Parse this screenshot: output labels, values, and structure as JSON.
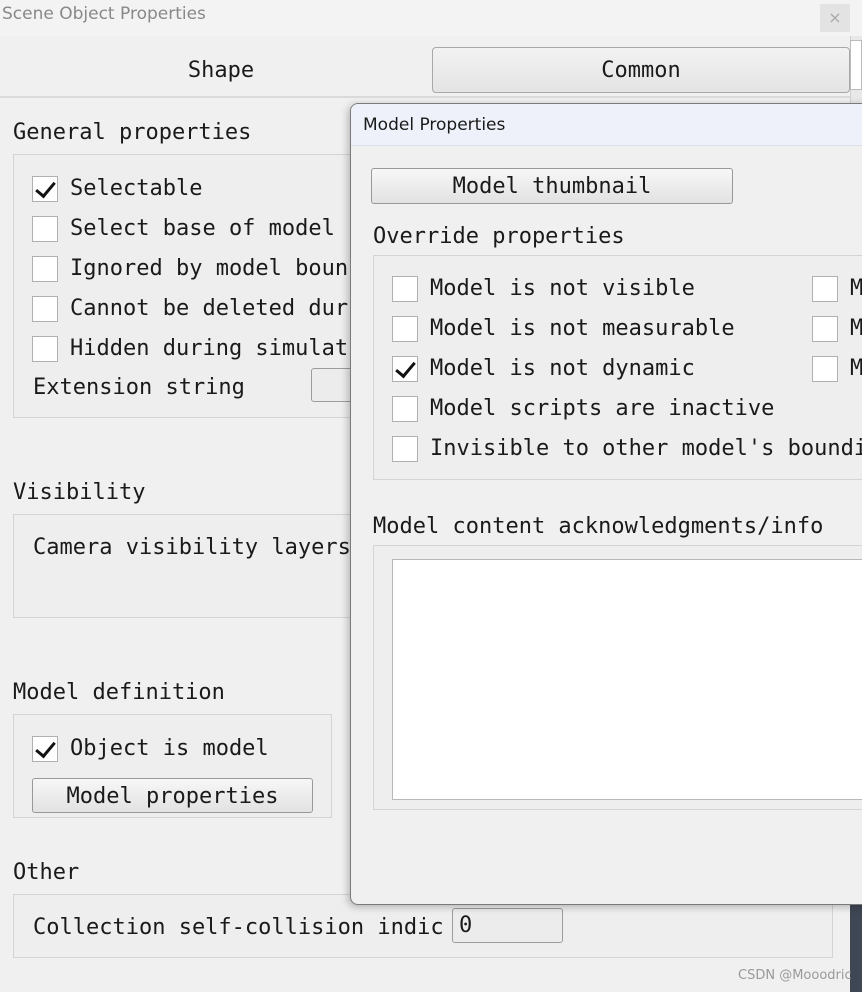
{
  "window": {
    "title": "Scene Object Properties",
    "close_glyph": "×"
  },
  "tabs": [
    {
      "label": "Shape"
    },
    {
      "label": "Common"
    }
  ],
  "general": {
    "title": "General properties",
    "items": [
      {
        "label": "Selectable",
        "checked": true
      },
      {
        "label": "Select base of model i",
        "checked": false
      },
      {
        "label": "Ignored by model bounc",
        "checked": false
      },
      {
        "label": "Cannot be deleted duri",
        "checked": false
      },
      {
        "label": "Hidden during simulati",
        "checked": false
      }
    ],
    "extension_label": "Extension string"
  },
  "visibility": {
    "title": "Visibility",
    "camera_layers_label": "Camera visibility layers"
  },
  "model_definition": {
    "title": "Model definition",
    "object_is_model_label": "Object is model",
    "object_is_model_checked": true,
    "model_properties_button": "Model properties"
  },
  "other": {
    "title": "Other",
    "collision_label": "Collection self-collision indic",
    "collision_value": "0"
  },
  "dialog": {
    "title": "Model Properties",
    "thumbnail_button": "Model thumbnail",
    "override_title": "Override properties",
    "override_items": [
      {
        "label": "Model is not visible",
        "checked": false
      },
      {
        "label": "Model is not measurable",
        "checked": false
      },
      {
        "label": "Model is not dynamic",
        "checked": true
      },
      {
        "label": "Model scripts are inactive",
        "checked": false
      },
      {
        "label": "Invisible to other model's boundir",
        "checked": false
      }
    ],
    "override_right_items": [
      {
        "label": "M",
        "checked": false
      },
      {
        "label": "M",
        "checked": false
      },
      {
        "label": "M",
        "checked": false
      }
    ],
    "info_title": "Model content acknowledgments/info",
    "info_text": ""
  },
  "watermark": "CSDN @Mooodric"
}
